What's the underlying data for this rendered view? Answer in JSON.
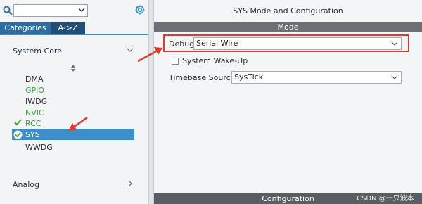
{
  "left_panel": {
    "search": {
      "value": "",
      "placeholder": ""
    },
    "tabs": [
      {
        "label": "Categories",
        "active": true
      },
      {
        "label": "A->Z",
        "active": false
      }
    ],
    "categories": [
      {
        "label": "System Core",
        "expanded": true
      },
      {
        "label": "Analog",
        "expanded": false
      }
    ],
    "items": [
      {
        "label": "DMA",
        "status": "plain"
      },
      {
        "label": "GPIO",
        "status": "green"
      },
      {
        "label": "IWDG",
        "status": "plain"
      },
      {
        "label": "NVIC",
        "status": "green"
      },
      {
        "label": "RCC",
        "status": "checked"
      },
      {
        "label": "SYS",
        "status": "selected"
      },
      {
        "label": "WWDG",
        "status": "plain"
      }
    ]
  },
  "right_panel": {
    "title": "SYS Mode and Configuration",
    "mode_header": "Mode",
    "debug": {
      "label": "Debug",
      "value": "Serial Wire"
    },
    "wakeup": {
      "label": "System Wake-Up",
      "checked": false
    },
    "timebase": {
      "label": "Timebase Source",
      "value": "SysTick"
    },
    "config_header": "Configuration"
  },
  "watermark": "CSDN @一只波本",
  "colors": {
    "accent_blue": "#3c8fc9",
    "tab_active": "#2b6ea3",
    "tab_inactive": "#1e4e79",
    "status_green": "#3aa23a",
    "annotation_red": "#e23a2a"
  }
}
